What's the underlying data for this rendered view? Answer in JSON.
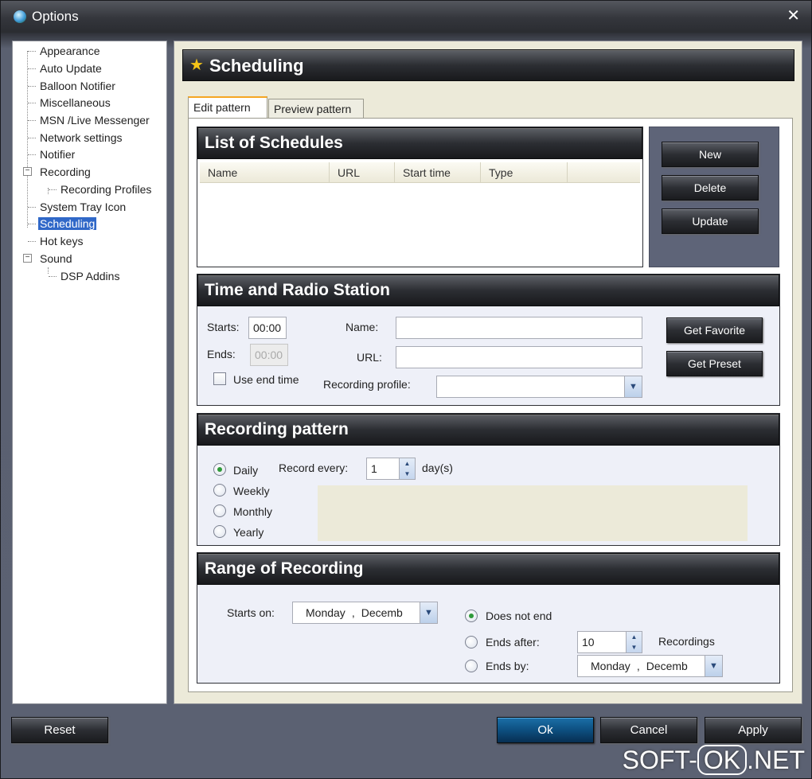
{
  "window": {
    "title": "Options",
    "close_icon": "✕"
  },
  "tree": {
    "items": [
      {
        "label": "Appearance"
      },
      {
        "label": "Auto Update"
      },
      {
        "label": "Balloon Notifier"
      },
      {
        "label": "Miscellaneous"
      },
      {
        "label": "MSN /Live Messenger"
      },
      {
        "label": "Network settings"
      },
      {
        "label": "Notifier"
      },
      {
        "label": "Recording"
      },
      {
        "label": "Recording Profiles"
      },
      {
        "label": "System Tray Icon"
      },
      {
        "label": "Scheduling",
        "selected": true
      },
      {
        "label": "Hot keys"
      },
      {
        "label": "Sound"
      },
      {
        "label": "DSP Addins"
      }
    ]
  },
  "page": {
    "title": "Scheduling",
    "tabs": [
      {
        "label": "Edit pattern",
        "active": true
      },
      {
        "label": "Preview pattern"
      }
    ]
  },
  "schedules": {
    "title": "List of Schedules",
    "columns": [
      "Name",
      "URL",
      "Start time",
      "Type"
    ],
    "rows": [],
    "buttons": {
      "new": "New",
      "delete": "Delete",
      "update": "Update"
    }
  },
  "time_station": {
    "title": "Time and Radio Station",
    "starts_label": "Starts:",
    "starts_value": "00:00",
    "ends_label": "Ends:",
    "ends_value": "00:00",
    "use_end_time_label": "Use end time",
    "name_label": "Name:",
    "name_value": "",
    "url_label": "URL:",
    "url_value": "",
    "profile_label": "Recording profile:",
    "profile_value": "",
    "get_favorite": "Get Favorite",
    "get_preset": "Get Preset"
  },
  "pattern": {
    "title": "Recording pattern",
    "options": [
      {
        "label": "Daily",
        "checked": true
      },
      {
        "label": "Weekly"
      },
      {
        "label": "Monthly"
      },
      {
        "label": "Yearly"
      }
    ],
    "record_every_label": "Record every:",
    "record_every_value": "1",
    "unit": "day(s)"
  },
  "range": {
    "title": "Range of Recording",
    "starts_on_label": "Starts on:",
    "starts_on_day": "Monday",
    "starts_on_month": "Decemb",
    "does_not_end": "Does not end",
    "ends_after": "Ends after:",
    "ends_after_value": "10",
    "recordings_label": "Recordings",
    "ends_by": "Ends by:",
    "ends_by_day": "Monday",
    "ends_by_month": "Decemb"
  },
  "footer": {
    "reset": "Reset",
    "ok": "Ok",
    "cancel": "Cancel",
    "apply": "Apply"
  },
  "watermark": {
    "left": "SOFT-",
    "mid": "OK",
    "right": ".NET"
  },
  "colors": {
    "selection": "#3068c8",
    "accent_tab": "#f5a623",
    "radio_dot": "#2f9a3a"
  },
  "icons": {
    "app": "globe-icon",
    "page": "star-icon",
    "close": "close-icon",
    "dropdown": "chevron-down-icon"
  }
}
